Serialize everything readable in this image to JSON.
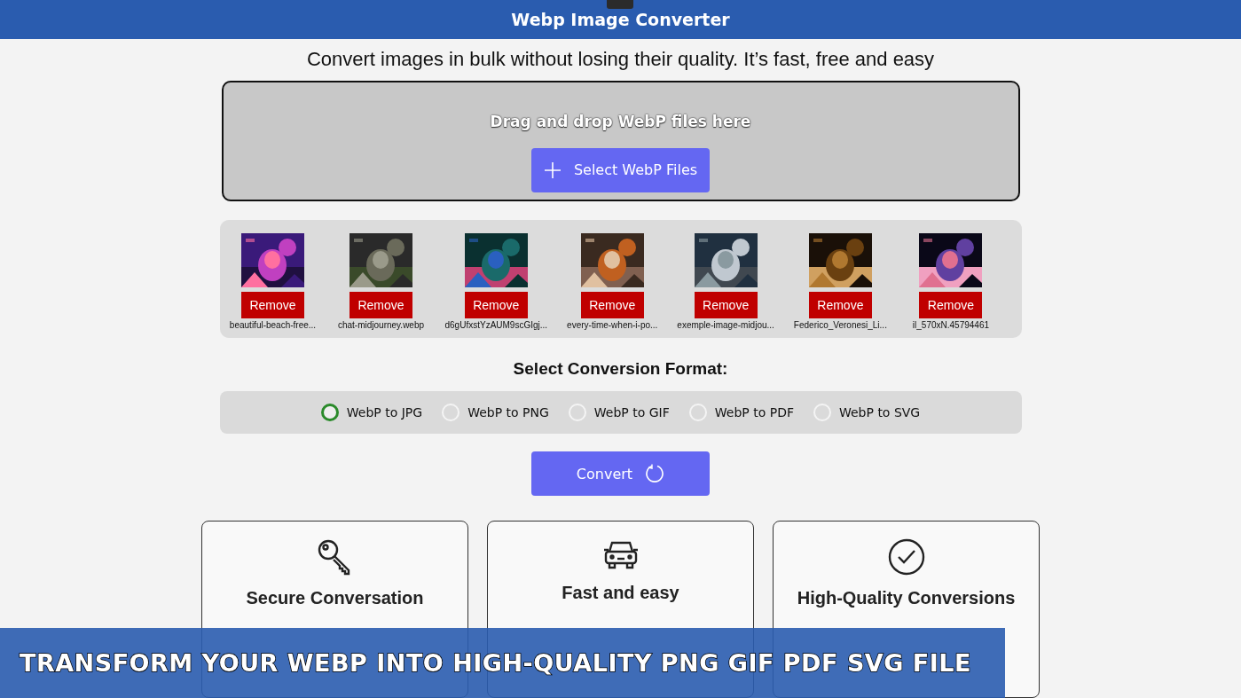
{
  "window": {
    "title": "Webp Image Converter"
  },
  "subtitle": "Convert images in bulk without losing their quality. It’s fast, free and easy",
  "drop_zone": {
    "hint": "Drag and drop WebP files here",
    "button": "Select WebP Files"
  },
  "files": [
    {
      "name": "beautiful-beach-free...",
      "remove": "Remove"
    },
    {
      "name": "chat-midjourney.webp",
      "remove": "Remove"
    },
    {
      "name": "d6gUfxstYzAUM9scGIgj...",
      "remove": "Remove"
    },
    {
      "name": "every-time-when-i-po...",
      "remove": "Remove"
    },
    {
      "name": "exemple-image-midjou...",
      "remove": "Remove"
    },
    {
      "name": "Federico_Veronesi_Li...",
      "remove": "Remove"
    },
    {
      "name": "il_570xN.45794461",
      "remove": "Remove"
    }
  ],
  "format_heading": "Select Conversion Format:",
  "formats": [
    {
      "label": "WebP to JPG",
      "selected": true
    },
    {
      "label": "WebP to PNG",
      "selected": false
    },
    {
      "label": "WebP to GIF",
      "selected": false
    },
    {
      "label": "WebP to PDF",
      "selected": false
    },
    {
      "label": "WebP to SVG",
      "selected": false
    }
  ],
  "convert_button": "Convert",
  "features": [
    {
      "title": "Secure Conversation"
    },
    {
      "title": "Fast and easy"
    },
    {
      "title": "High-Quality Conversions"
    }
  ],
  "banner": "TRANSFORM YOUR WEBP INTO HIGH-QUALITY PNG GIF PDF SVG FILE"
}
